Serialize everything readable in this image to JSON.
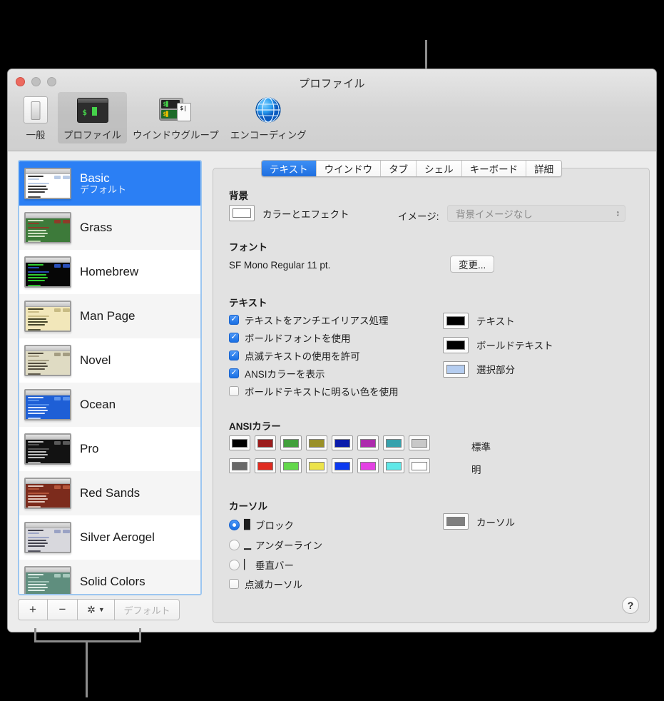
{
  "window": {
    "title": "プロファイル",
    "traffic_lights": [
      "close",
      "minimize",
      "zoom"
    ]
  },
  "toolbar": {
    "items": [
      {
        "label": "一般",
        "icon": "general-icon",
        "selected": false
      },
      {
        "label": "プロファイル",
        "icon": "terminal-icon",
        "selected": true
      },
      {
        "label": "ウインドウグループ",
        "icon": "window-group-icon",
        "selected": false
      },
      {
        "label": "エンコーディング",
        "icon": "globe-icon",
        "selected": false
      }
    ]
  },
  "profile_list": {
    "items": [
      {
        "name": "Basic",
        "subtitle": "デフォルト",
        "selected": true,
        "bg": "#ffffff",
        "fg": "#2b2b2b",
        "accent": "#b9cbe6"
      },
      {
        "name": "Grass",
        "subtitle": "",
        "selected": false,
        "bg": "#3d7a3a",
        "fg": "#d6e6c8",
        "accent": "#8e3b28"
      },
      {
        "name": "Homebrew",
        "subtitle": "",
        "selected": false,
        "bg": "#060606",
        "fg": "#33d833",
        "accent": "#2a4fb8"
      },
      {
        "name": "Man Page",
        "subtitle": "",
        "selected": false,
        "bg": "#f2e7ba",
        "fg": "#3b3b20",
        "accent": "#c8bb84"
      },
      {
        "name": "Novel",
        "subtitle": "",
        "selected": false,
        "bg": "#dfdbc3",
        "fg": "#4a4437",
        "accent": "#a49d82"
      },
      {
        "name": "Ocean",
        "subtitle": "",
        "selected": false,
        "bg": "#1e5fd6",
        "fg": "#e3ecff",
        "accent": "#5a93ee"
      },
      {
        "name": "Pro",
        "subtitle": "",
        "selected": false,
        "bg": "#121212",
        "fg": "#c9c9c9",
        "accent": "#5a5a5a"
      },
      {
        "name": "Red Sands",
        "subtitle": "",
        "selected": false,
        "bg": "#7c2b1c",
        "fg": "#e8cfc4",
        "accent": "#b7573c"
      },
      {
        "name": "Silver Aerogel",
        "subtitle": "",
        "selected": false,
        "bg": "#d8d8dd",
        "fg": "#3a3a45",
        "accent": "#9aa2c4"
      },
      {
        "name": "Solid Colors",
        "subtitle": "",
        "selected": false,
        "bg": "#5f8e7e",
        "fg": "#e2f0ea",
        "accent": "#a7c9bd"
      }
    ],
    "buttons": {
      "add": "+",
      "remove": "−",
      "gear": "gear-icon",
      "gear_caret": "chevron-down-icon",
      "default": "デフォルト"
    }
  },
  "tabs": [
    {
      "label": "テキスト",
      "active": true
    },
    {
      "label": "ウインドウ",
      "active": false
    },
    {
      "label": "タブ",
      "active": false
    },
    {
      "label": "シェル",
      "active": false
    },
    {
      "label": "キーボード",
      "active": false
    },
    {
      "label": "詳細",
      "active": false
    }
  ],
  "text_pane": {
    "background": {
      "heading": "背景",
      "color_effects_label": "カラーとエフェクト",
      "color_well": "#ffffff",
      "image_label": "イメージ:",
      "image_value": "背景イメージなし"
    },
    "font": {
      "heading": "フォント",
      "value": "SF Mono Regular 11 pt.",
      "change_button": "変更..."
    },
    "text": {
      "heading": "テキスト",
      "checkboxes": [
        {
          "label": "テキストをアンチエイリアス処理",
          "checked": true
        },
        {
          "label": "ボールドフォントを使用",
          "checked": true
        },
        {
          "label": "点滅テキストの使用を許可",
          "checked": true
        },
        {
          "label": "ANSIカラーを表示",
          "checked": true
        },
        {
          "label": "ボールドテキストに明るい色を使用",
          "checked": false
        }
      ],
      "wells": [
        {
          "label": "テキスト",
          "color": "#000000"
        },
        {
          "label": "ボールドテキスト",
          "color": "#000000"
        },
        {
          "label": "選択部分",
          "color": "#b5cdf0"
        }
      ]
    },
    "ansi": {
      "heading": "ANSIカラー",
      "normal_label": "標準",
      "bright_label": "明",
      "normal": [
        "#000000",
        "#9c1c1c",
        "#42a03c",
        "#9a9028",
        "#0a1bab",
        "#ad2bad",
        "#37a2ad",
        "#c8c8c8"
      ],
      "bright": [
        "#686868",
        "#e02b20",
        "#63d84b",
        "#ece34a",
        "#0b39f0",
        "#e340e3",
        "#5fe8e8",
        "#ffffff"
      ]
    },
    "cursor": {
      "heading": "カーソル",
      "options": [
        {
          "label": "ブロック",
          "glyph": "▉",
          "selected": true
        },
        {
          "label": "アンダーライン",
          "glyph": "▁",
          "selected": false
        },
        {
          "label": "垂直バー",
          "glyph": "▏",
          "selected": false
        }
      ],
      "blink": {
        "label": "点滅カーソル",
        "checked": false
      },
      "well": {
        "label": "カーソル",
        "color": "#7f7f7f"
      }
    },
    "help_button": "?"
  },
  "callouts": [
    {
      "name": "tabs-callout",
      "target": "tab-bar"
    },
    {
      "name": "list-buttons-callout",
      "target": "profile-list-buttons"
    }
  ]
}
